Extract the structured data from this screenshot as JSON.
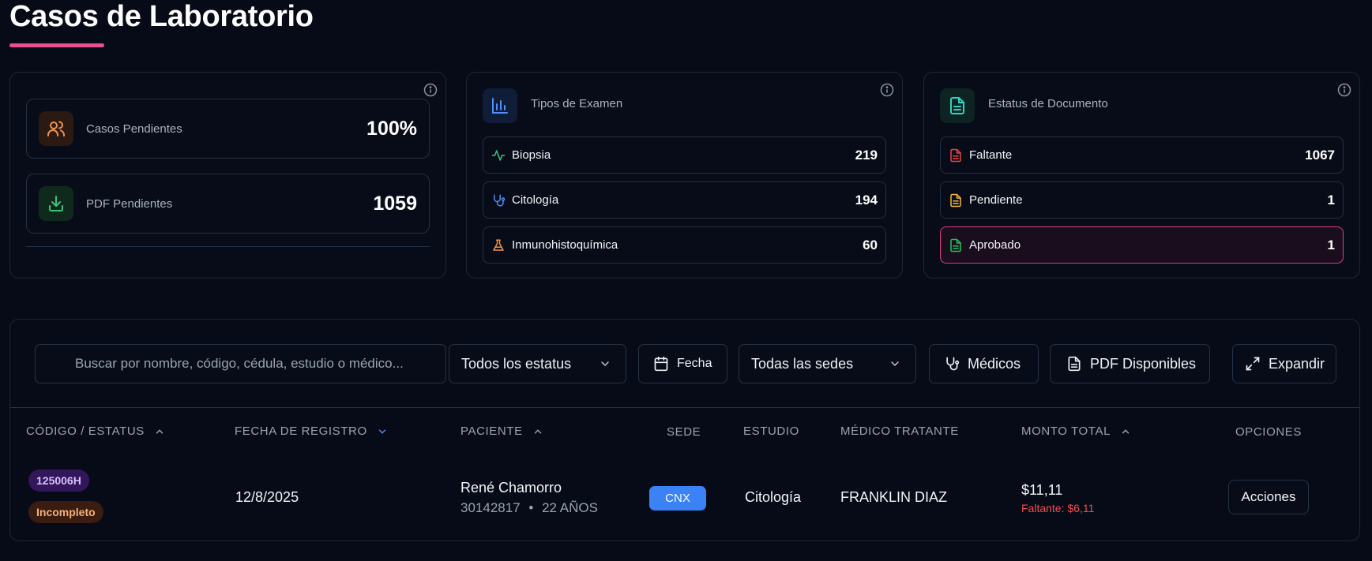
{
  "page": {
    "title": "Casos de Laboratorio"
  },
  "summary": {
    "casos_pendientes": {
      "label": "Casos Pendientes",
      "value": "100%"
    },
    "pdf_pendientes": {
      "label": "PDF Pendientes",
      "value": "1059"
    }
  },
  "tipos_examen": {
    "title": "Tipos de Examen",
    "items": [
      {
        "label": "Biopsia",
        "value": "219",
        "icon": "activity-icon"
      },
      {
        "label": "Citología",
        "value": "194",
        "icon": "stethoscope-icon"
      },
      {
        "label": "Inmunohistoquímica",
        "value": "60",
        "icon": "flask-icon"
      }
    ]
  },
  "estatus_documento": {
    "title": "Estatus de Documento",
    "items": [
      {
        "label": "Faltante",
        "value": "1067",
        "color": "#ef4444"
      },
      {
        "label": "Pendiente",
        "value": "1",
        "color": "#f5b83d"
      },
      {
        "label": "Aprobado",
        "value": "1",
        "color": "#22c55e"
      }
    ]
  },
  "filters": {
    "search_placeholder": "Buscar por nombre, código, cédula, estudio o médico...",
    "estatus": "Todos los estatus",
    "fecha": "Fecha",
    "sedes": "Todas las sedes",
    "medicos": "Médicos",
    "pdf": "PDF Disponibles",
    "expandir": "Expandir"
  },
  "table": {
    "headers": {
      "codigo": "CÓDIGO / ESTATUS",
      "fecha": "FECHA DE REGISTRO",
      "paciente": "PACIENTE",
      "sede": "SEDE",
      "estudio": "ESTUDIO",
      "medico": "MÉDICO TRATANTE",
      "monto": "MONTO TOTAL",
      "opciones": "OPCIONES"
    },
    "rows": [
      {
        "codigo": "125006H",
        "estatus": "Incompleto",
        "fecha": "12/8/2025",
        "paciente": "René Chamorro",
        "cedula": "30142817",
        "separador": "•",
        "edad": "22 AÑOS",
        "sede": "CNX",
        "estudio": "Citología",
        "medico": "FRANKLIN DIAZ",
        "monto": "$11,11",
        "faltante": "Faltante: $6,11",
        "acciones": "Acciones"
      }
    ]
  },
  "colors": {
    "accent": "#e8508f",
    "background": "#060b17",
    "sede_badge": "#3b82f6"
  }
}
